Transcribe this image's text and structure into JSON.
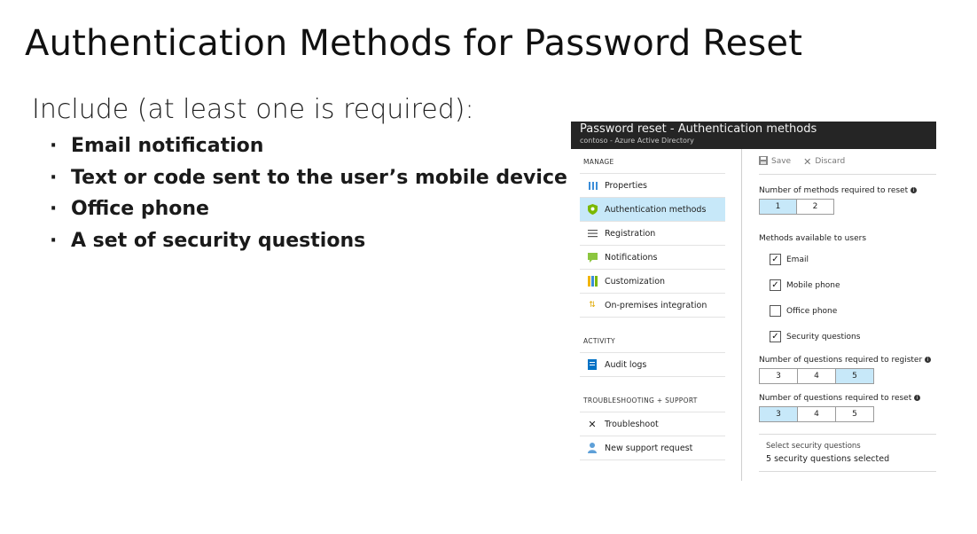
{
  "slide": {
    "title": "Authentication Methods for Password Reset",
    "subtitle": "Include (at least one is required):",
    "bullets": [
      "Email notification",
      "Text or code sent to the user’s mobile device",
      "Office phone",
      "A set of security questions"
    ]
  },
  "blade": {
    "title": "Password reset - Authentication methods",
    "subtitle": "contoso - Azure Active Directory",
    "nav": {
      "manage_header": "MANAGE",
      "manage_items": [
        "Properties",
        "Authentication methods",
        "Registration",
        "Notifications",
        "Customization",
        "On-premises integration"
      ],
      "activity_header": "ACTIVITY",
      "activity_items": [
        "Audit logs"
      ],
      "support_header": "TROUBLESHOOTING + SUPPORT",
      "support_items": [
        "Troubleshoot",
        "New support request"
      ]
    },
    "toolbar": {
      "save": "Save",
      "discard": "Discard"
    },
    "methods_required": {
      "label": "Number of methods required to reset",
      "options": [
        "1",
        "2"
      ],
      "selected": "1"
    },
    "methods_available": {
      "label": "Methods available to users",
      "items": [
        {
          "label": "Email",
          "checked": true
        },
        {
          "label": "Mobile phone",
          "checked": true
        },
        {
          "label": "Office phone",
          "checked": false
        },
        {
          "label": "Security questions",
          "checked": true
        }
      ]
    },
    "questions_register": {
      "label": "Number of questions required to register",
      "options": [
        "3",
        "4",
        "5"
      ],
      "selected": "5"
    },
    "questions_reset": {
      "label": "Number of questions required to reset",
      "options": [
        "3",
        "4",
        "5"
      ],
      "selected": "3"
    },
    "select_questions": {
      "label": "Select security questions",
      "value": "5 security questions selected"
    }
  },
  "colors": {
    "header_bg": "#252525",
    "selected_bg": "#c7e8f9",
    "shield": "#7ab800"
  }
}
